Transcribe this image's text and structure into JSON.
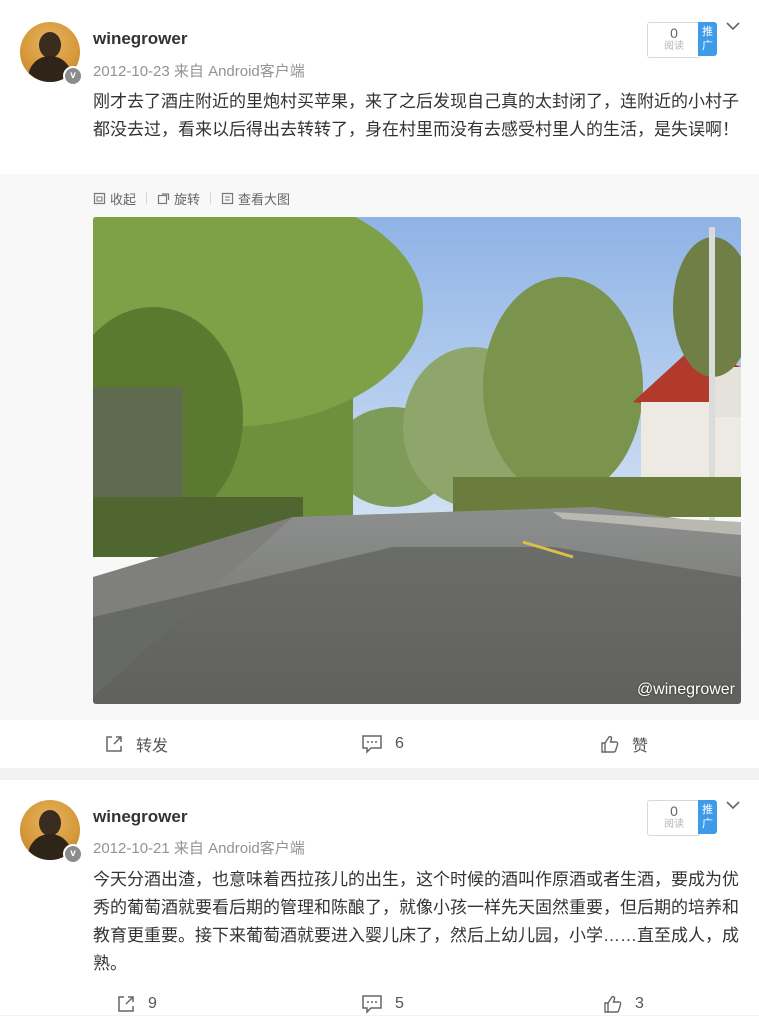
{
  "posts": [
    {
      "username": "winegrower",
      "date": "2012-10-23",
      "source": "来自 Android客户端",
      "read_count": "0",
      "read_label": "阅读",
      "promote_label": "推广",
      "text": "刚才去了酒庄附近的里炮村买苹果，来了之后发现自己真的太封闭了，连附近的小村子都没去过，看来以后得出去转转了，身在村里而没有去感受村里人的生活，是失误啊！",
      "media_tools": {
        "collapse": "收起",
        "rotate": "旋转",
        "view_large": "查看大图"
      },
      "watermark": "@winegrower",
      "actions": {
        "repost": "转发",
        "comments": "6",
        "like": "赞"
      }
    },
    {
      "username": "winegrower",
      "date": "2012-10-21",
      "source": "来自 Android客户端",
      "read_count": "0",
      "read_label": "阅读",
      "promote_label": "推广",
      "text": "今天分酒出渣，也意味着西拉孩儿的出生，这个时候的酒叫作原酒或者生酒，要成为优秀的葡萄酒就要看后期的管理和陈酿了，就像小孩一样先天固然重要，但后期的培养和教育更重要。接下来葡萄酒就要进入婴儿床了，然后上幼儿园，小学……直至成人，成熟。",
      "actions": {
        "repost": "9",
        "comments": "5",
        "like": "3"
      }
    }
  ],
  "icons": {
    "verified_badge": "v",
    "repost": "share-out-icon",
    "comment": "comment-icon",
    "like": "thumbs-up-icon",
    "chevron": "chevron-down-icon"
  },
  "colors": {
    "accent": "#3d9be9",
    "meta": "#939393"
  }
}
